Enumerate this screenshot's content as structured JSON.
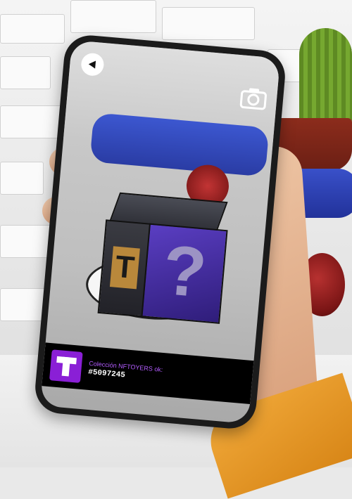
{
  "ar_view": {
    "back_icon": "back-arrow-icon",
    "camera_icon": "camera-icon"
  },
  "product": {
    "logo_letter": "T",
    "box_letter": "T",
    "box_symbol": "?",
    "collection_label": "Colección NFTOYERS ok:",
    "code": "#5097245"
  },
  "colors": {
    "brand_purple": "#8a1fd6",
    "label_purple": "#b35cff",
    "bar_black": "#000000"
  }
}
